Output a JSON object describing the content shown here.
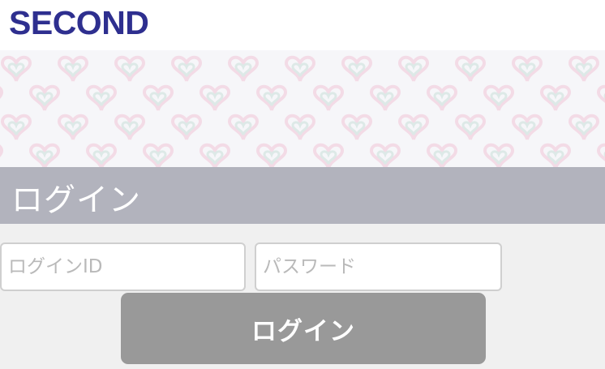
{
  "header": {
    "logo_text": "SECOND"
  },
  "pattern": {
    "icon": "heart-icon",
    "outer_color": "#f3dbe6",
    "inner_color": "#dde9e7"
  },
  "login_section": {
    "title": "ログイン"
  },
  "form": {
    "login_id": {
      "value": "",
      "placeholder": "ログインID"
    },
    "password": {
      "value": "",
      "placeholder": "パスワード"
    },
    "submit_label": "ログイン"
  },
  "colors": {
    "brand": "#2e2f8f",
    "section_bar": "#b2b3bd",
    "button": "#999999",
    "background": "#f0f0f0"
  }
}
